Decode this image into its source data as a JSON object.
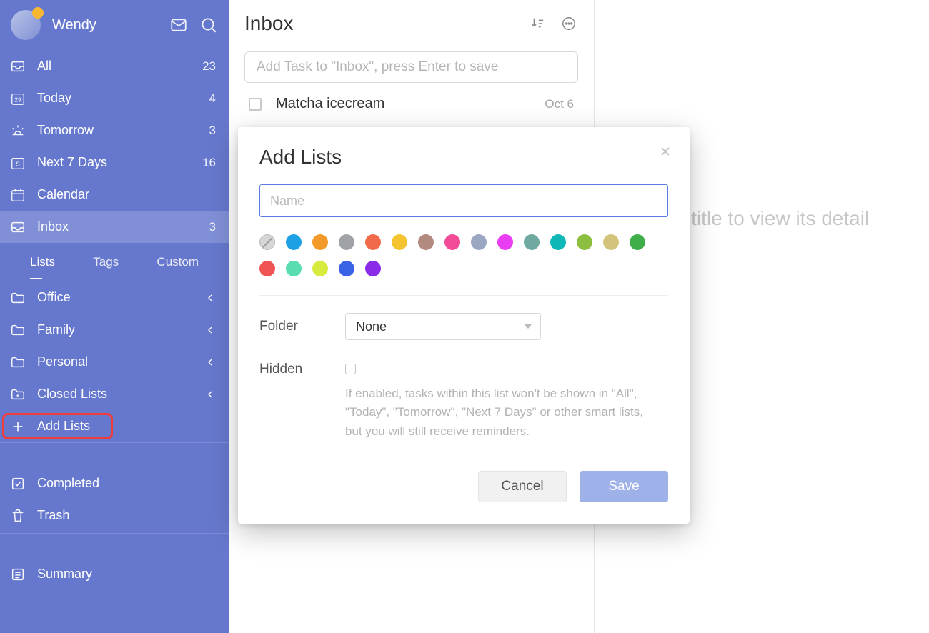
{
  "user": {
    "name": "Wendy"
  },
  "smart_lists": [
    {
      "key": "all",
      "label": "All",
      "count": 23,
      "icon": "tray"
    },
    {
      "key": "today",
      "label": "Today",
      "count": 4,
      "icon": "cal29"
    },
    {
      "key": "tomorrow",
      "label": "Tomorrow",
      "count": 3,
      "icon": "sunrise"
    },
    {
      "key": "next7",
      "label": "Next 7 Days",
      "count": 16,
      "icon": "sevendays"
    },
    {
      "key": "calendar",
      "label": "Calendar",
      "count": null,
      "icon": "calendar"
    },
    {
      "key": "inbox",
      "label": "Inbox",
      "count": 3,
      "icon": "inbox",
      "selected": true
    }
  ],
  "sidebar_tabs": {
    "items": [
      "Lists",
      "Tags",
      "Custom"
    ],
    "active": "Lists"
  },
  "folders": [
    {
      "label": "Office"
    },
    {
      "label": "Family"
    },
    {
      "label": "Personal"
    },
    {
      "label": "Closed Lists"
    }
  ],
  "add_lists_label": "Add Lists",
  "bottom_items": [
    {
      "label": "Completed",
      "icon": "check"
    },
    {
      "label": "Trash",
      "icon": "trash"
    }
  ],
  "summary_label": "Summary",
  "center": {
    "title": "Inbox",
    "add_placeholder": "Add Task to \"Inbox\", press Enter to save",
    "tasks": [
      {
        "title": "Matcha icecream",
        "date": "Oct 6"
      }
    ]
  },
  "detail_placeholder": "ask title to view its detail",
  "modal": {
    "title": "Add Lists",
    "name_placeholder": "Name",
    "name_value": "",
    "colors": [
      "none",
      "#1ea0e6",
      "#f29b2a",
      "#9fa3a8",
      "#f16a4a",
      "#f5c431",
      "#b28a7f",
      "#f24b97",
      "#9aa6c2",
      "#e83df2",
      "#6fa9a0",
      "#0fb7b7",
      "#8cbf3f",
      "#d4c37a",
      "#3fae4a",
      "#f05454",
      "#58dcb0",
      "#d9ea3e",
      "#3a63e6",
      "#8b2bea"
    ],
    "folder_label": "Folder",
    "folder_value": "None",
    "hidden_label": "Hidden",
    "hidden_description": "If enabled, tasks within this list won't be shown in \"All\", \"Today\", \"Tomorrow\", \"Next 7 Days\" or other smart lists, but you will still receive reminders.",
    "cancel": "Cancel",
    "save": "Save"
  }
}
